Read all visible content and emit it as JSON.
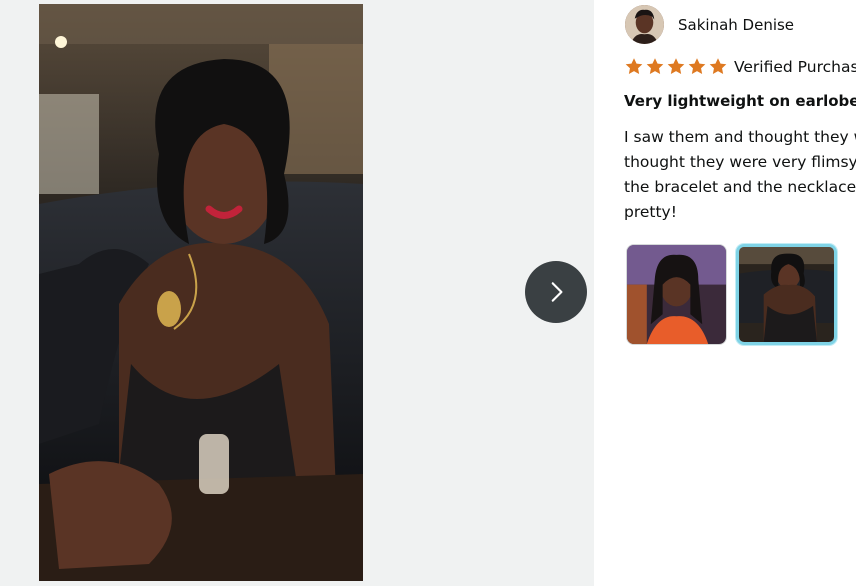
{
  "viewer": {
    "photo_icon": "review-photo",
    "next_icon": "chevron-right-icon"
  },
  "review": {
    "reviewer_name": "Sakinah Denise",
    "rating": 5,
    "rating_max": 5,
    "star_color": "#de7921",
    "verified_label": "Verified Purchase",
    "title": "Very lightweight on earlobes",
    "body_lines": [
      "I saw them and thought they were",
      "thought they were very flimsy. I",
      "the bracelet and the necklace. T",
      "pretty!"
    ]
  },
  "thumbnails": {
    "selected_index": 1,
    "count": 2,
    "selected_border_color": "#7fd3e6"
  }
}
